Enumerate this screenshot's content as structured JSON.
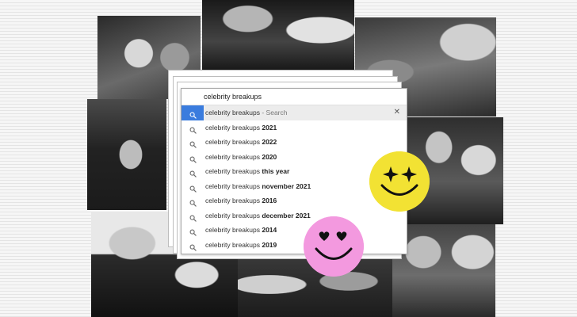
{
  "search": {
    "query": "celebrity breakups",
    "suggestions": [
      {
        "base": "celebrity breakups",
        "suffix": "",
        "hint": "- Search",
        "active": true
      },
      {
        "base": "celebrity breakups ",
        "suffix": "2021",
        "hint": "",
        "active": false
      },
      {
        "base": "celebrity breakups ",
        "suffix": "2022",
        "hint": "",
        "active": false
      },
      {
        "base": "celebrity breakups ",
        "suffix": "2020",
        "hint": "",
        "active": false
      },
      {
        "base": "celebrity breakups ",
        "suffix": "this year",
        "hint": "",
        "active": false
      },
      {
        "base": "celebrity breakups ",
        "suffix": "november 2021",
        "hint": "",
        "active": false
      },
      {
        "base": "celebrity breakups ",
        "suffix": "2016",
        "hint": "",
        "active": false
      },
      {
        "base": "celebrity breakups ",
        "suffix": "december 2021",
        "hint": "",
        "active": false
      },
      {
        "base": "celebrity breakups ",
        "suffix": "2014",
        "hint": "",
        "active": false
      },
      {
        "base": "celebrity breakups ",
        "suffix": "2019",
        "hint": "",
        "active": false
      }
    ]
  },
  "icons": {
    "search": "magnifier-icon",
    "clear": "close-icon",
    "emoji_yellow": "star-eyes-smiley-icon",
    "emoji_pink": "heart-eyes-smiley-icon"
  },
  "colors": {
    "accent": "#3a7cde",
    "smiley_yellow": "#f2e233",
    "smiley_pink": "#f399df"
  }
}
